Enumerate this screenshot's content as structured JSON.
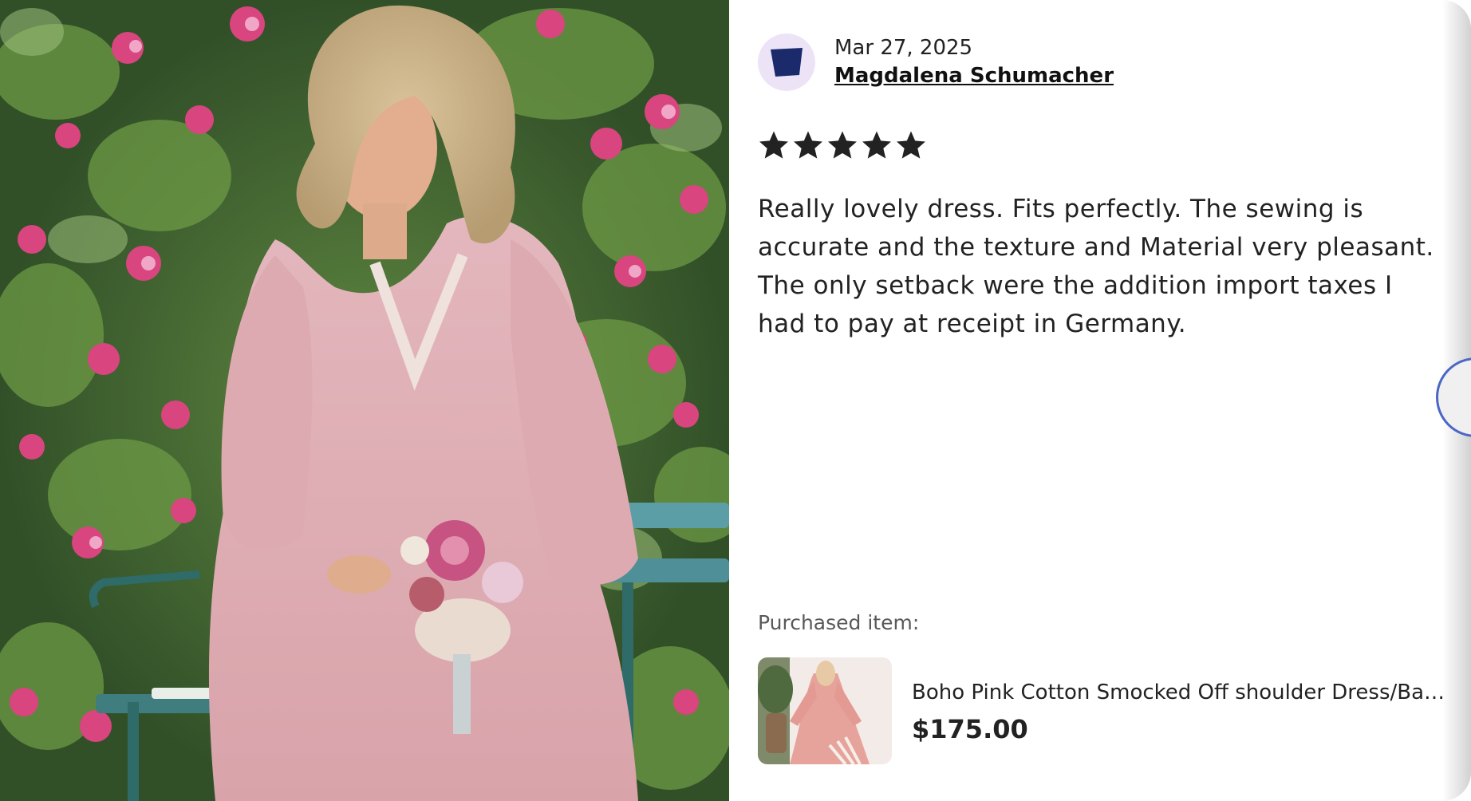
{
  "review": {
    "date": "Mar 27, 2025",
    "reviewer_name": "Magdalena Schumacher",
    "rating": 5,
    "rating_max": 5,
    "text": "Really lovely dress. Fits perfectly. The sewing is accurate and the texture and Material very pleasant. The only setback were the addition import taxes I had to pay at receipt in Germany."
  },
  "purchased": {
    "label": "Purchased item:",
    "title": "Boho Pink Cotton Smocked Off shoulder Dress/Bab...",
    "price": "$175.00"
  },
  "icons": {
    "avatar": "abstract-avatar-icon",
    "star": "star-filled-icon",
    "side_button": "next-button"
  },
  "colors": {
    "avatar_bg": "#ede3f7",
    "avatar_shape": "#1b2a6b",
    "star": "#222222",
    "accent": "#4b66c7"
  }
}
